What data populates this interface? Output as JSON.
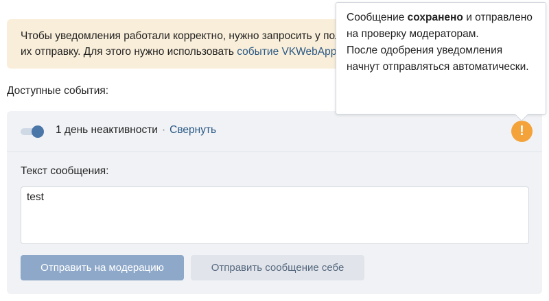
{
  "notice": {
    "line1": "Чтобы уведомления работали корректно, нужно запросить у пользователя разрешение на",
    "line2_prefix": "их отправку. Для этого нужно использовать ",
    "line2_link": "событие VKWebAppAllowNotifications"
  },
  "events": {
    "label": "Доступные события:"
  },
  "event": {
    "toggle_on": true,
    "title": "1 день неактивности",
    "separator": "·",
    "collapse_label": "Свернуть",
    "warning_icon": "exclamation-icon",
    "warning_glyph": "!"
  },
  "message": {
    "label": "Текст сообщения:",
    "value": "test"
  },
  "buttons": {
    "moderation": "Отправить на модерацию",
    "send_self": "Отправить сообщение себе"
  },
  "tooltip": {
    "part1": "Сообщение ",
    "bold": "сохранено",
    "part2": " и отправлено на проверку модераторам.",
    "line2": "После одобрения уведомления начнут отправляться автоматически."
  },
  "colors": {
    "accent": "#4a76a8",
    "link": "#2a5885",
    "warning": "#f4a23a",
    "notice_bg": "#f9eed9"
  }
}
